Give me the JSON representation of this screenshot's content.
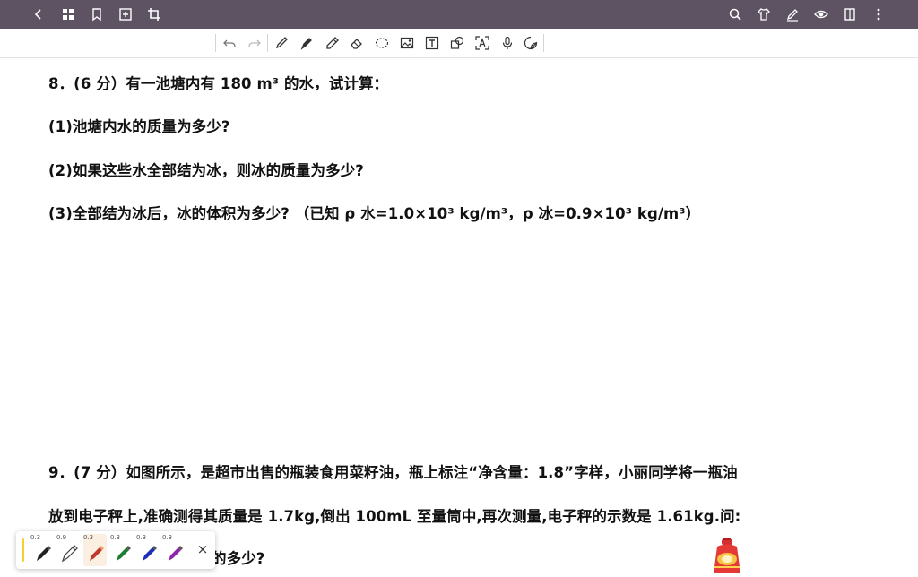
{
  "topbar": {
    "left_icons": [
      "back-icon",
      "grid-icon",
      "bookmark-icon",
      "add-page-icon",
      "crop-icon"
    ],
    "right_icons": [
      "search-icon",
      "shirt-icon",
      "pen-style-icon",
      "eye-icon",
      "page-layout-icon",
      "more-icon"
    ]
  },
  "toolbar": {
    "tools": [
      "undo-icon",
      "redo-icon",
      "pen-icon",
      "fountain-pen-icon",
      "highlighter-icon",
      "eraser-icon",
      "lasso-icon",
      "image-icon",
      "text-box-icon",
      "shapes-icon",
      "text-recognize-icon",
      "microphone-icon",
      "sticker-icon"
    ]
  },
  "document": {
    "q8": {
      "line1": "8．(6 分）有一池塘内有  180 m³ 的水，试计算：",
      "line2": "(1)池塘内水的质量为多少?",
      "line3": "(2)如果这些水全部结为冰，则冰的质量为多少?",
      "line4": "(3)全部结为冰后，冰的体积为多少?  （已知  ρ 水=1.0×10³ kg/m³，ρ 冰=0.9×10³ kg/m³）"
    },
    "q9": {
      "line1": "9．(7 分）如图所示，是超市出售的瓶装食用菜籽油，瓶上标注“净含量：1.8”字样，小丽同学将一瓶油",
      "line2": "放到电子秤上,准确测得其质量是 1.7kg,倒出 100mL 至量筒中,再次测量,电子秤的示数是 1.61kg.问:",
      "line3_partial": "的多少?"
    }
  },
  "pen_tray": {
    "pens": [
      {
        "width": "0.3",
        "color": "#222222"
      },
      {
        "width": "0.9",
        "color": "#444444"
      },
      {
        "width": "0.3",
        "color": "#c0392b"
      },
      {
        "width": "0.3",
        "color": "#1e7d32"
      },
      {
        "width": "0.3",
        "color": "#1d2fb8"
      },
      {
        "width": "0.3",
        "color": "#8e24aa"
      }
    ],
    "selected_index": 2,
    "close_label": "×"
  },
  "colors": {
    "topbar": "#5d5363",
    "accent_bar": "#f5cf2f"
  }
}
